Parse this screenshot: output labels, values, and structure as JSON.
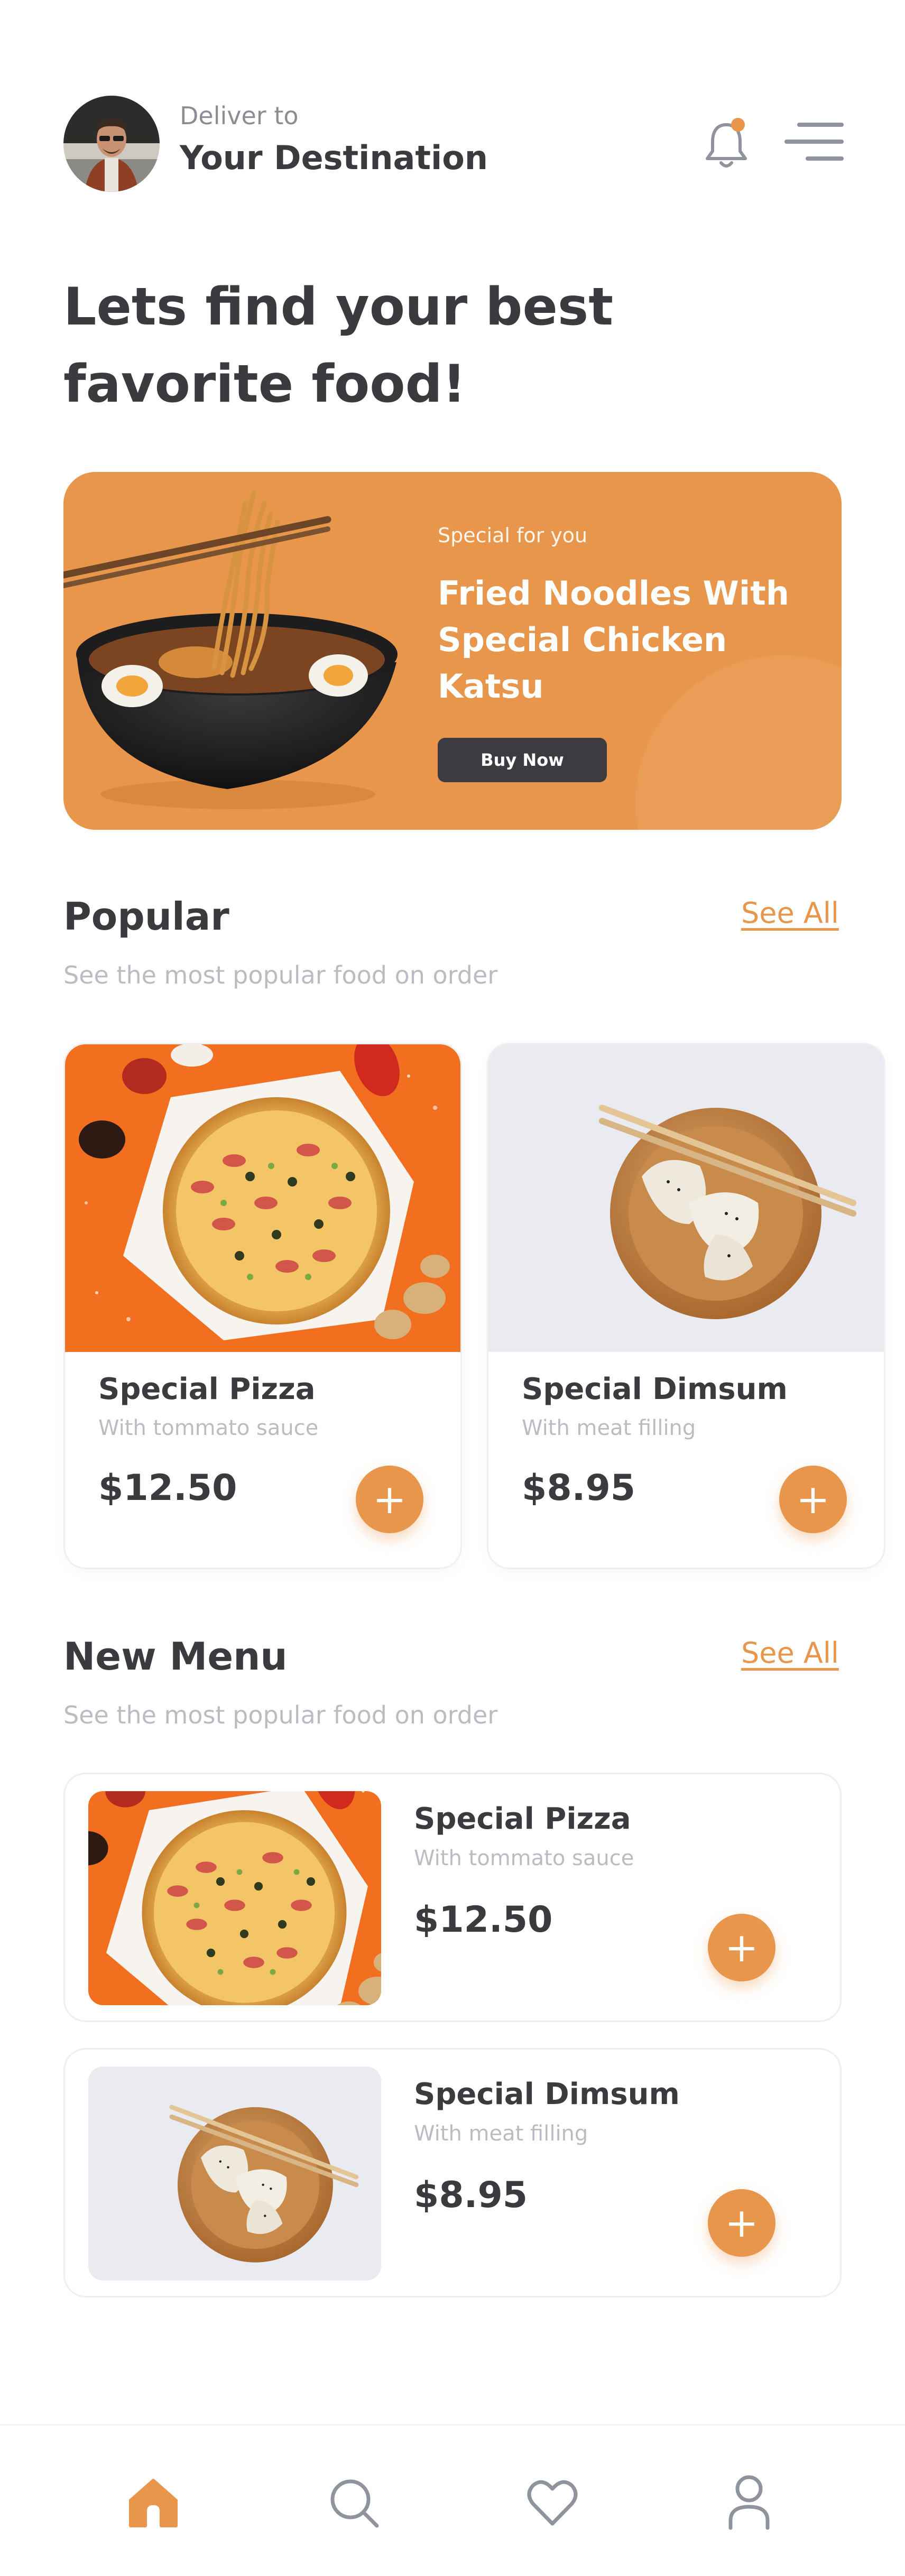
{
  "header": {
    "deliver_label": "Deliver to",
    "destination": "Your Destination",
    "icons": [
      "avatar",
      "bell-icon",
      "menu-icon"
    ]
  },
  "headline": "Lets find your best favorite food!",
  "promo": {
    "tag": "Special for you",
    "title": "Fried Noodles With Special Chicken Katsu",
    "button_label": "Buy Now",
    "background_color": "#e8964b"
  },
  "popular": {
    "title": "Popular",
    "see_all": "See All",
    "subtitle": "See the most popular food on order",
    "items": [
      {
        "name": "Special Pizza",
        "description": "With tommato sauce",
        "price": "$12.50",
        "add_label": "+"
      },
      {
        "name": "Special Dimsum",
        "description": "With meat filling",
        "price": "$8.95",
        "add_label": "+"
      }
    ]
  },
  "new_menu": {
    "title": "New Menu",
    "see_all": "See All",
    "subtitle": "See the most popular food on order",
    "items": [
      {
        "name": "Special Pizza",
        "description": "With tommato sauce",
        "price": "$12.50",
        "add_label": "+"
      },
      {
        "name": "Special Dimsum",
        "description": "With meat filling",
        "price": "$8.95",
        "add_label": "+"
      }
    ]
  },
  "bottom_nav": {
    "items": [
      "home-icon",
      "search-icon",
      "heart-icon",
      "profile-icon"
    ],
    "active": "home-icon"
  },
  "colors": {
    "accent": "#e8964b",
    "text_dark": "#3a3a3f",
    "text_muted": "#b9bcc3",
    "icon_gray": "#8f949c"
  }
}
